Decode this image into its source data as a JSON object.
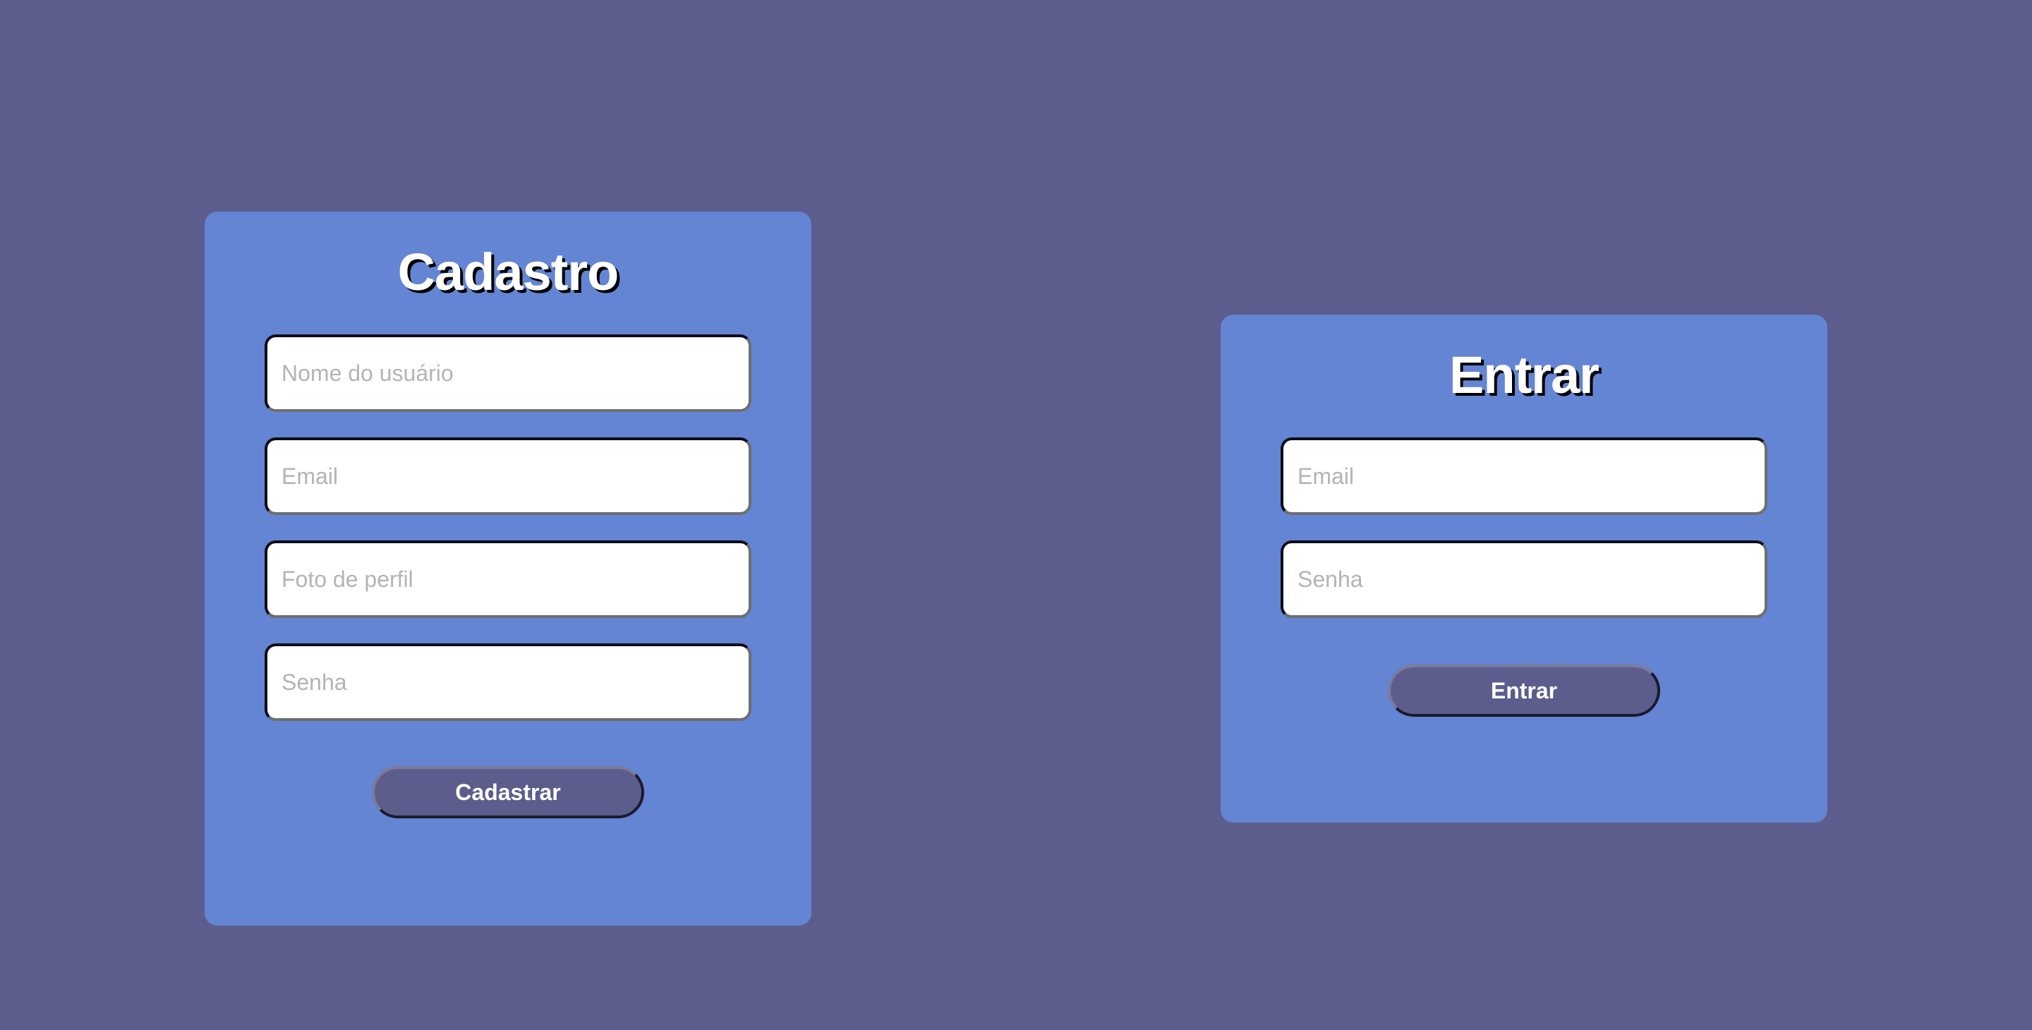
{
  "colors": {
    "background": "#5c5d8d",
    "card": "#6484d4",
    "button": "#5c5d8d",
    "text": "#ffffff"
  },
  "signup": {
    "title": "Cadastro",
    "fields": [
      {
        "placeholder": "Nome do usuário"
      },
      {
        "placeholder": "Email"
      },
      {
        "placeholder": "Foto de perfil"
      },
      {
        "placeholder": "Senha"
      }
    ],
    "button_label": "Cadastrar"
  },
  "login": {
    "title": "Entrar",
    "fields": [
      {
        "placeholder": "Email"
      },
      {
        "placeholder": "Senha"
      }
    ],
    "button_label": "Entrar"
  }
}
